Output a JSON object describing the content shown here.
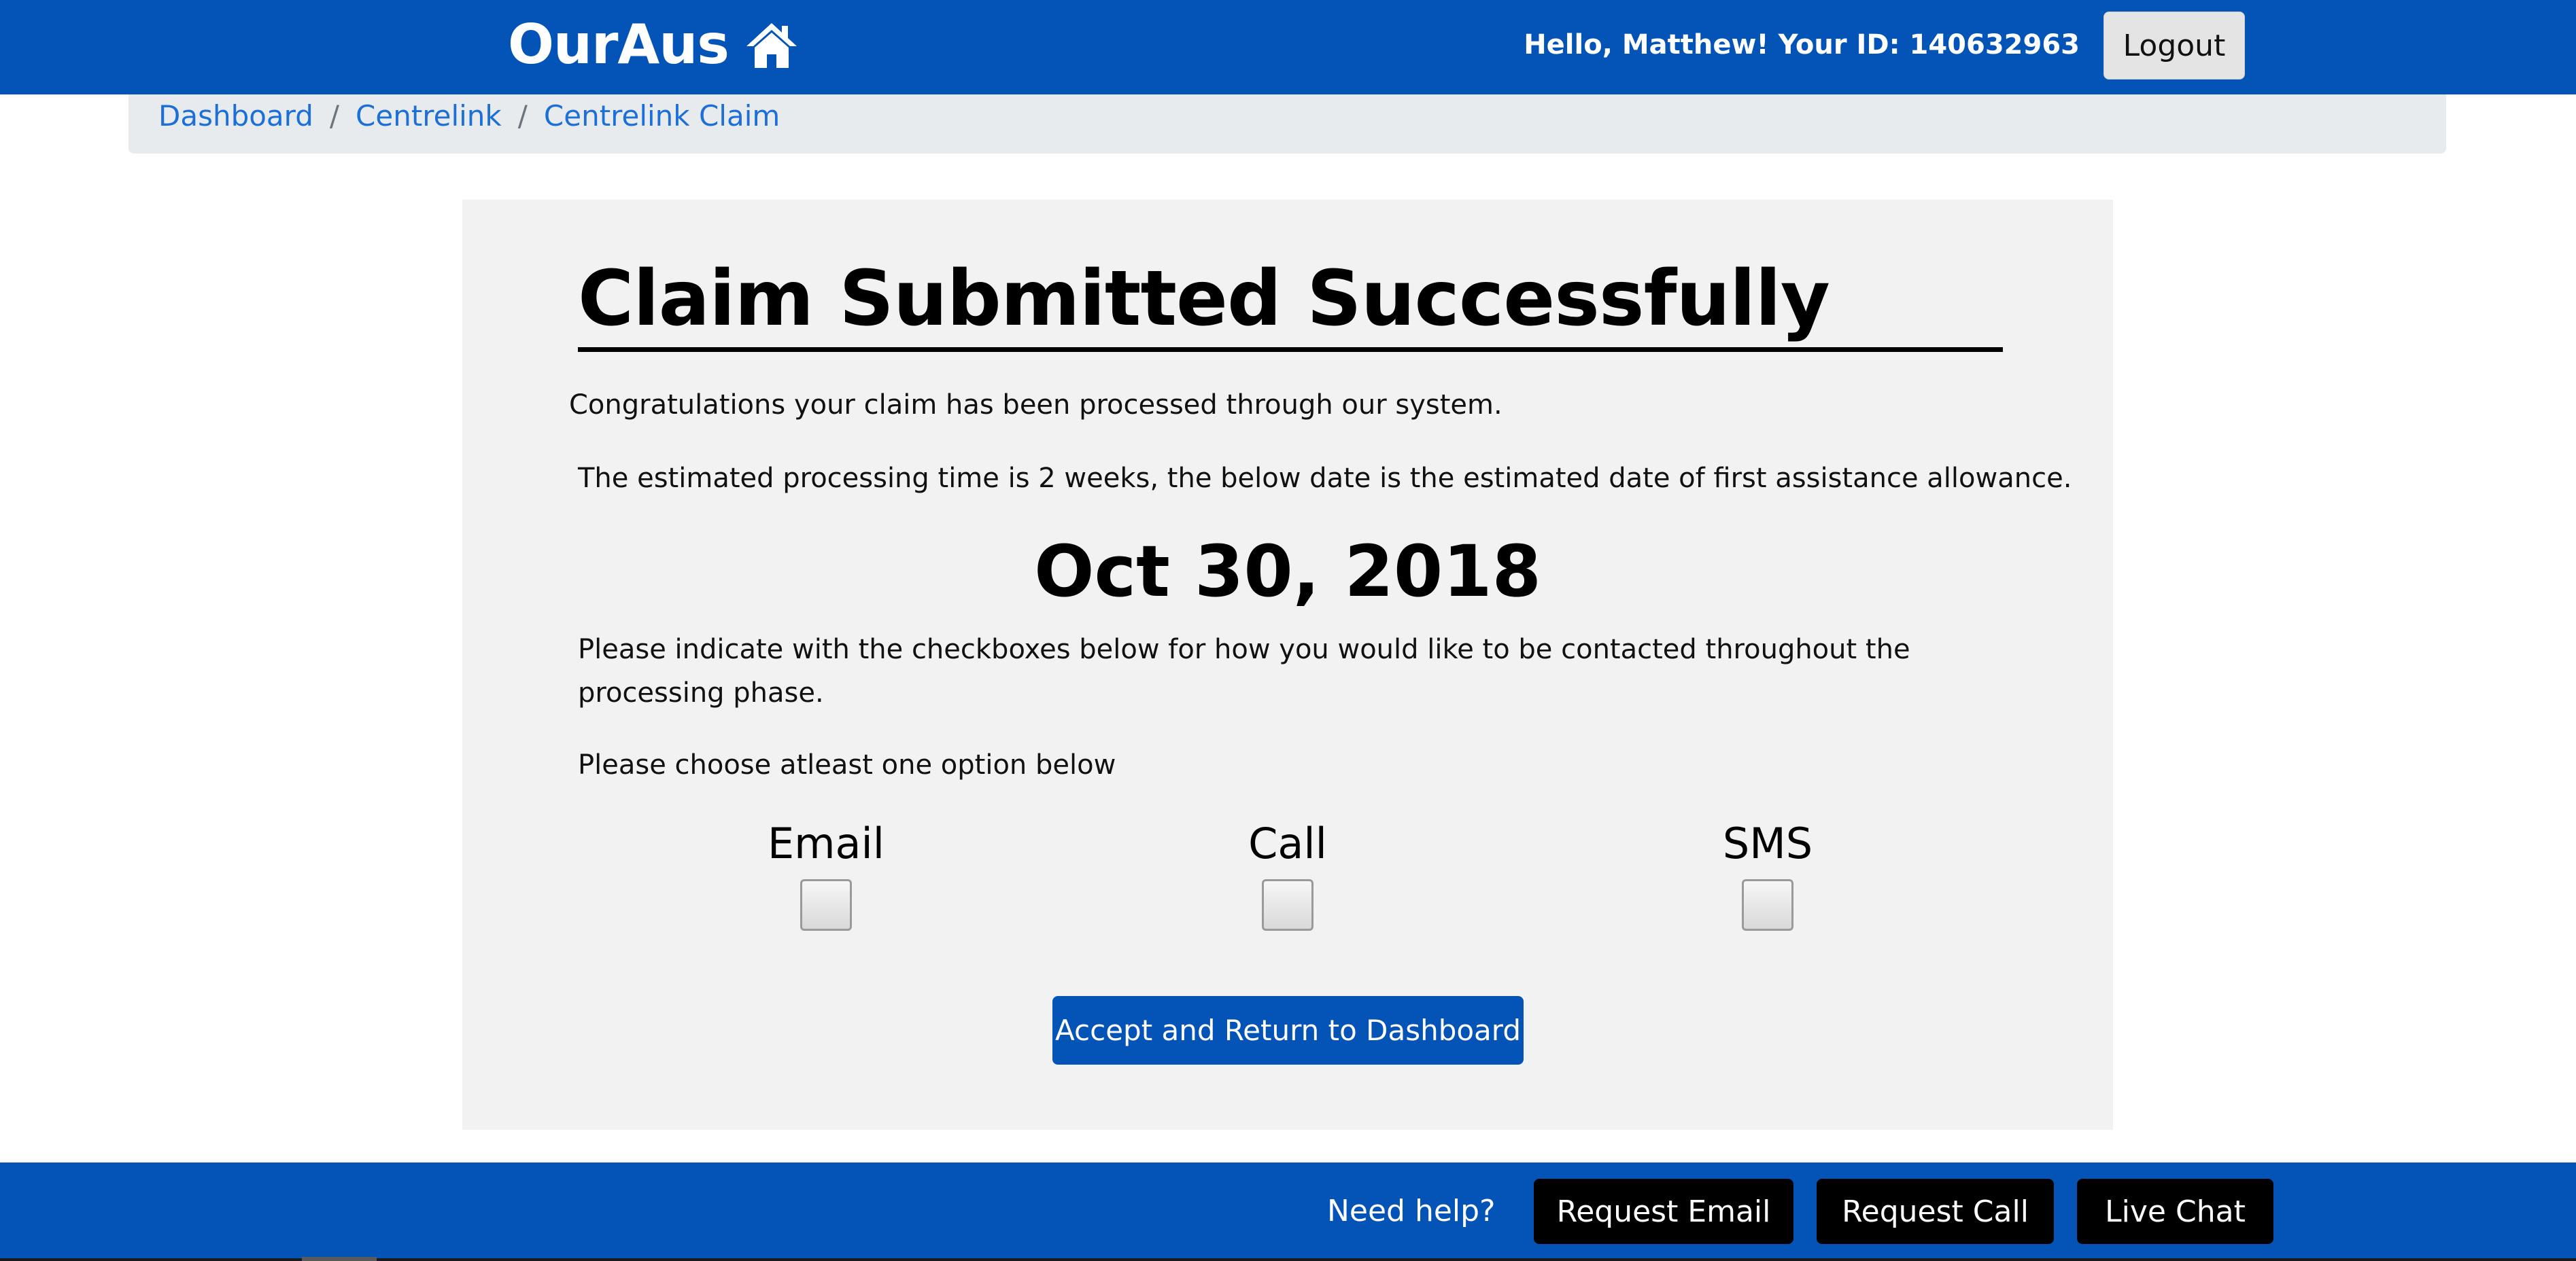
{
  "header": {
    "brand": "OurAus",
    "brand_icon": "home-icon",
    "greeting": "Hello, Matthew! Your ID: 140632963",
    "logout_label": "Logout"
  },
  "breadcrumb": {
    "items": [
      {
        "label": "Dashboard"
      },
      {
        "label": "Centrelink"
      },
      {
        "label": "Centrelink Claim"
      }
    ],
    "separator": "/"
  },
  "main": {
    "title": "Claim Submitted Successfully",
    "congrats": "Congratulations your claim has been processed through our system.",
    "estimated": "The estimated processing time is 2 weeks, the below date is the estimated date of first assistance allowance.",
    "date": "Oct 30, 2018",
    "indicate": "Please indicate with the checkboxes below for how you would like to be contacted throughout the processing phase.",
    "choose": "Please choose atleast one option below",
    "options": [
      {
        "label": "Email",
        "checked": false
      },
      {
        "label": "Call",
        "checked": false
      },
      {
        "label": "SMS",
        "checked": false
      }
    ],
    "accept_label": "Accept and Return to Dashboard"
  },
  "footer": {
    "help_text": "Need help?",
    "buttons": [
      {
        "label": "Request Email"
      },
      {
        "label": "Request Call"
      },
      {
        "label": "Live Chat"
      }
    ]
  },
  "colors": {
    "primary": "#0454b8",
    "link": "#1c6fd8",
    "panel": "#f2f2f2",
    "breadcrumb_bg": "#e8ebee"
  }
}
